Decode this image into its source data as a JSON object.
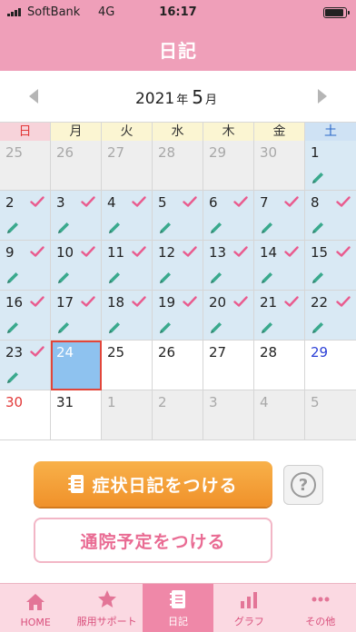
{
  "status_bar": {
    "carrier": "SoftBank",
    "network": "4G",
    "time": "16:17"
  },
  "nav": {
    "title": "日記"
  },
  "month_nav": {
    "year": "2021",
    "year_unit": "年",
    "month": "5",
    "month_unit": "月"
  },
  "weekdays": [
    "日",
    "月",
    "火",
    "水",
    "木",
    "金",
    "土"
  ],
  "days": [
    {
      "n": "25",
      "out": true
    },
    {
      "n": "26",
      "out": true
    },
    {
      "n": "27",
      "out": true
    },
    {
      "n": "28",
      "out": true
    },
    {
      "n": "29",
      "out": true
    },
    {
      "n": "30",
      "out": true
    },
    {
      "n": "1",
      "log": true,
      "pencil": true
    },
    {
      "n": "2",
      "log": true,
      "check": true,
      "pencil": true
    },
    {
      "n": "3",
      "log": true,
      "check": true,
      "pencil": true
    },
    {
      "n": "4",
      "log": true,
      "check": true,
      "pencil": true
    },
    {
      "n": "5",
      "log": true,
      "check": true,
      "pencil": true
    },
    {
      "n": "6",
      "log": true,
      "check": true,
      "pencil": true
    },
    {
      "n": "7",
      "log": true,
      "check": true,
      "pencil": true
    },
    {
      "n": "8",
      "log": true,
      "check": true,
      "pencil": true
    },
    {
      "n": "9",
      "log": true,
      "check": true,
      "pencil": true
    },
    {
      "n": "10",
      "log": true,
      "check": true,
      "pencil": true
    },
    {
      "n": "11",
      "log": true,
      "check": true,
      "pencil": true
    },
    {
      "n": "12",
      "log": true,
      "check": true,
      "pencil": true
    },
    {
      "n": "13",
      "log": true,
      "check": true,
      "pencil": true
    },
    {
      "n": "14",
      "log": true,
      "check": true,
      "pencil": true
    },
    {
      "n": "15",
      "log": true,
      "check": true,
      "pencil": true
    },
    {
      "n": "16",
      "log": true,
      "check": true,
      "pencil": true
    },
    {
      "n": "17",
      "log": true,
      "check": true,
      "pencil": true
    },
    {
      "n": "18",
      "log": true,
      "check": true,
      "pencil": true
    },
    {
      "n": "19",
      "log": true,
      "check": true,
      "pencil": true
    },
    {
      "n": "20",
      "log": true,
      "check": true,
      "pencil": true
    },
    {
      "n": "21",
      "log": true,
      "check": true,
      "pencil": true
    },
    {
      "n": "22",
      "log": true,
      "check": true,
      "pencil": true
    },
    {
      "n": "23",
      "log": true,
      "check": true,
      "pencil": true
    },
    {
      "n": "24",
      "selected": true
    },
    {
      "n": "25"
    },
    {
      "n": "26"
    },
    {
      "n": "27"
    },
    {
      "n": "28"
    },
    {
      "n": "29",
      "saturday": true
    },
    {
      "n": "30",
      "sunday": true
    },
    {
      "n": "31"
    },
    {
      "n": "1",
      "out": true
    },
    {
      "n": "2",
      "out": true
    },
    {
      "n": "3",
      "out": true
    },
    {
      "n": "4",
      "out": true
    },
    {
      "n": "5",
      "out": true
    }
  ],
  "actions": {
    "symptom_diary_label": "症状日記をつける",
    "visit_plan_label": "通院予定をつける",
    "help_label": "?"
  },
  "tabs": [
    {
      "label": "HOME",
      "icon": "home-icon",
      "active": false
    },
    {
      "label": "服用サポート",
      "icon": "star-icon",
      "active": false
    },
    {
      "label": "日記",
      "icon": "notebook-icon",
      "active": true
    },
    {
      "label": "グラフ",
      "icon": "bar-chart-icon",
      "active": false
    },
    {
      "label": "その他",
      "icon": "more-dots-icon",
      "active": false
    }
  ],
  "colors": {
    "brand_pink": "#ef9fb9",
    "logged_day": "#d9e9f4",
    "check": "#e95b8e",
    "pencil": "#3aa98d",
    "selected_day": "#8ec2ef",
    "primary_button": "#f0912a"
  }
}
